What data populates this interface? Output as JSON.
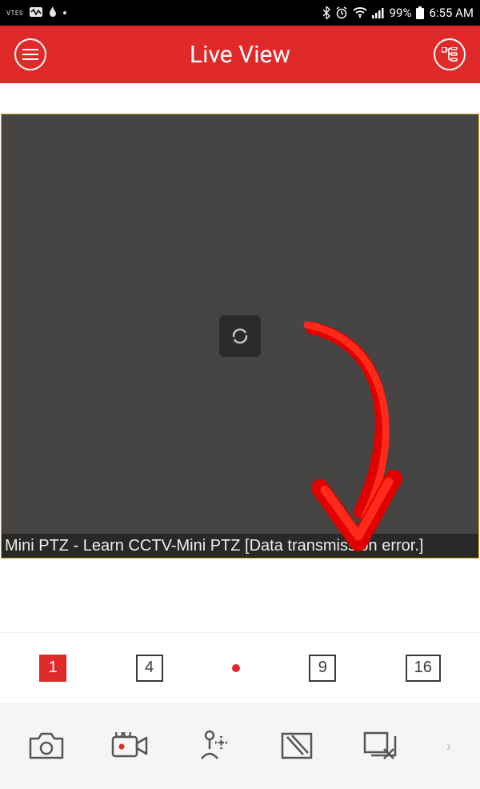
{
  "status_bar": {
    "left_text": "VTES",
    "battery_pct": "99%",
    "time": "6:55 AM"
  },
  "header": {
    "title": "Live View"
  },
  "video": {
    "caption": "Mini PTZ - Learn CCTV-Mini PTZ [Data transmission error.]"
  },
  "layout_tabs": {
    "n1": "1",
    "n4": "4",
    "n9": "9",
    "n16": "16"
  },
  "colors": {
    "accent": "#e02a2a"
  }
}
